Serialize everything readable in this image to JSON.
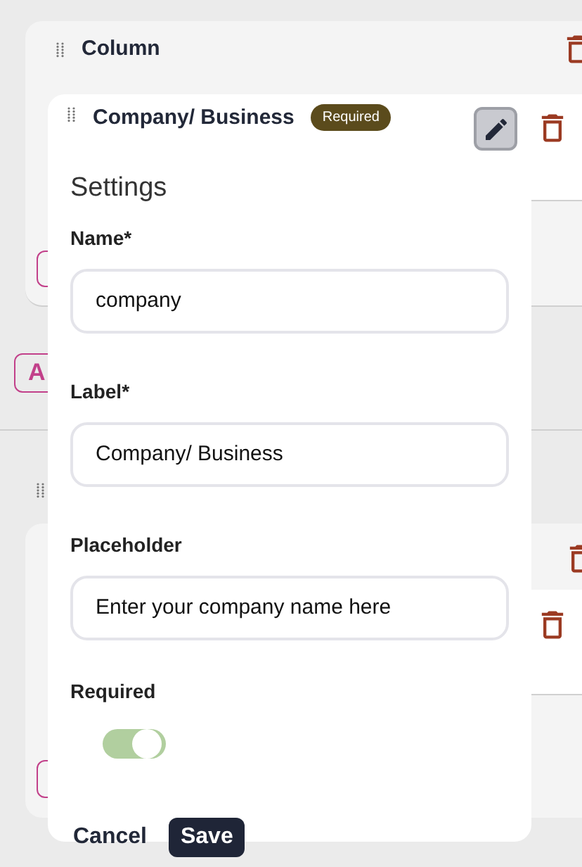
{
  "column": {
    "title": "Column"
  },
  "field": {
    "title": "Company/ Business",
    "badge": "Required"
  },
  "settings": {
    "heading": "Settings",
    "fields": [
      {
        "label": "Name*",
        "value": "company"
      },
      {
        "label": "Label*",
        "value": "Company/ Business"
      },
      {
        "label": "Placeholder",
        "value": "Enter your company name here"
      }
    ],
    "required": {
      "label": "Required",
      "on": true
    },
    "buttons": [
      "Cancel",
      "Save"
    ]
  },
  "add_button": {
    "label": "A"
  }
}
